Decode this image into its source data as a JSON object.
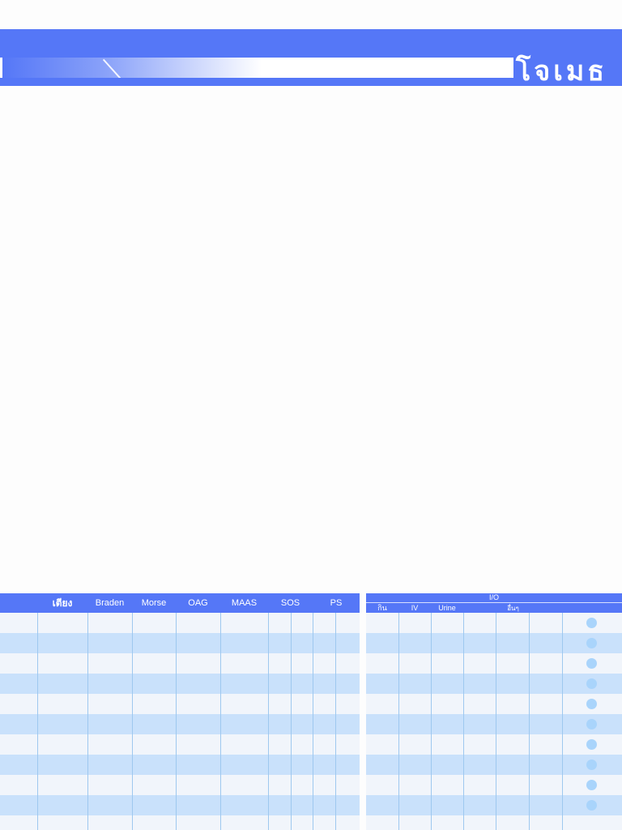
{
  "header": {
    "title": "โจเมธ"
  },
  "left_table": {
    "columns": [
      "",
      "เตียง",
      "Braden",
      "Morse",
      "OAG",
      "MAAS",
      "SOS",
      "PS"
    ]
  },
  "right_table": {
    "group_label": "I/O",
    "sub_columns": [
      "กิน",
      "IV",
      "Urine",
      "อื่นๆ"
    ]
  },
  "colors": {
    "accent": "#5577f7",
    "row_light": "#f1f5fb",
    "row_dark": "#c9e1fb",
    "grid_line": "#9ec8ef",
    "dot": "#a9d4fb"
  },
  "row_count": 11
}
